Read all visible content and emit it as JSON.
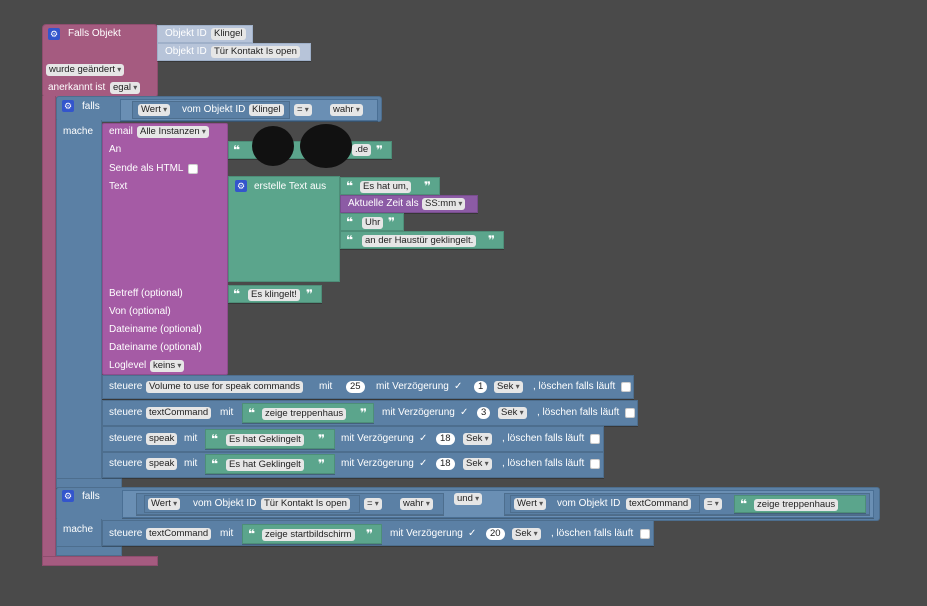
{
  "event": {
    "title": "Falls Objekt",
    "obj_label": "Objekt ID",
    "obj1": "Klingel",
    "obj2": "Tür Kontakt Is open",
    "changed": "wurde geändert",
    "ack_label": "anerkannt ist",
    "ack": "egal"
  },
  "if1": {
    "falls": "falls",
    "mache": "mache",
    "cond": {
      "wert": "Wert",
      "vom": "vom Objekt ID",
      "obj": "Klingel",
      "op": "=",
      "val": "wahr"
    }
  },
  "email": {
    "label": "email",
    "instances": "Alle Instanzen",
    "an": "An",
    "an_suffix": ".de",
    "html": "Sende als HTML",
    "text": "Text",
    "create_text": "erstelle Text aus",
    "text_items": [
      "Es hat um,",
      "Uhr",
      "an der Haustür geklingelt."
    ],
    "time_label": "Aktuelle Zeit als",
    "time_format": "SS:mm",
    "betreff": "Betreff (optional)",
    "betreff_val": "Es klingelt!",
    "von": "Von (optional)",
    "datei1": "Dateiname (optional)",
    "datei2": "Dateiname (optional)",
    "loglevel": "Loglevel",
    "loglevel_val": "keins"
  },
  "control": {
    "steuere": "steuere",
    "mit": "mit",
    "delay": "mit Verzögerung",
    "unit": "Sek",
    "clear": ", löschen falls läuft",
    "rows": [
      {
        "target": "Volume to use for speak commands",
        "value": "25",
        "delay": "1"
      },
      {
        "target": "textCommand",
        "value": "zeige treppenhaus",
        "delay": "3"
      },
      {
        "target": "speak",
        "value": "Es hat Geklingelt",
        "delay": "18"
      },
      {
        "target": "speak",
        "value": "Es hat Geklingelt",
        "delay": "18"
      }
    ]
  },
  "if2": {
    "falls": "falls",
    "mache": "mache",
    "c1": {
      "wert": "Wert",
      "vom": "vom Objekt ID",
      "obj": "Tür Kontakt Is open",
      "op": "=",
      "val": "wahr"
    },
    "and": "und",
    "c2": {
      "wert": "Wert",
      "vom": "vom Objekt ID",
      "obj": "textCommand",
      "op": "=",
      "val": "zeige treppenhaus"
    },
    "action": {
      "target": "textCommand",
      "value": "zeige startbildschirm",
      "delay": "20"
    }
  },
  "colors": {
    "event": "#a55b80",
    "logic": "#5b80a5",
    "email": "#a55ba5",
    "text": "#5ba58c",
    "time": "#8c5ba5"
  }
}
